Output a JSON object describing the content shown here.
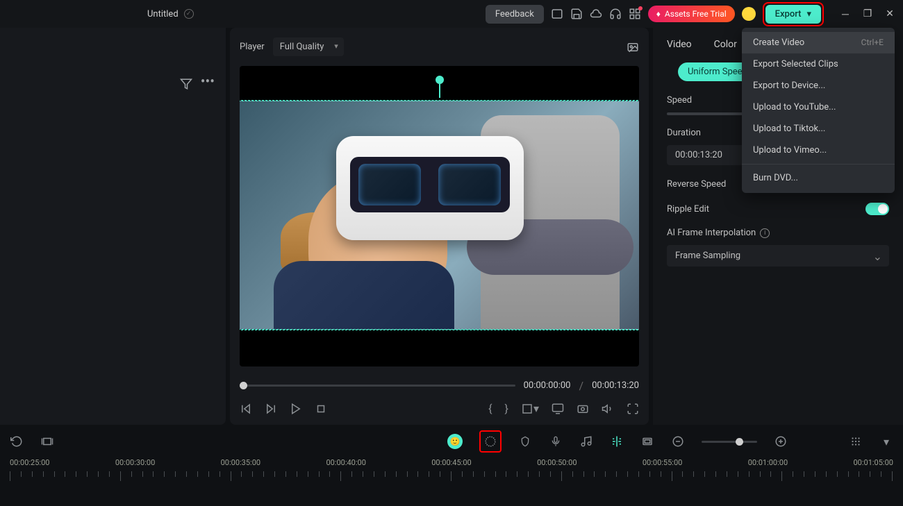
{
  "titlebar": {
    "title": "Untitled",
    "feedback": "Feedback",
    "assets_pill": "Assets Free Trial",
    "export": "Export"
  },
  "export_menu": {
    "items": [
      {
        "label": "Create Video",
        "shortcut": "Ctrl+E",
        "hovered": true
      },
      {
        "label": "Export Selected Clips"
      },
      {
        "label": "Export to Device..."
      },
      {
        "label": "Upload to YouTube..."
      },
      {
        "label": "Upload to Tiktok..."
      },
      {
        "label": "Upload to Vimeo..."
      }
    ],
    "footer": {
      "label": "Burn DVD..."
    }
  },
  "preview": {
    "player_label": "Player",
    "quality": "Full Quality",
    "current_time": "00:00:00:00",
    "total_time": "00:00:13:20"
  },
  "right_panel": {
    "tabs": [
      "Video",
      "Color"
    ],
    "speed_mode": "Uniform Speed",
    "speed_label": "Speed",
    "duration_label": "Duration",
    "duration_value": "00:00:13:20",
    "reverse_label": "Reverse Speed",
    "ripple_label": "Ripple Edit",
    "ai_label": "AI Frame Interpolation",
    "ai_value": "Frame Sampling"
  },
  "timeline": {
    "labels": [
      "00:00:25:00",
      "00:00:30:00",
      "00:00:35:00",
      "00:00:40:00",
      "00:00:45:00",
      "00:00:50:00",
      "00:00:55:00",
      "00:01:00:00",
      "00:01:05:00"
    ]
  }
}
